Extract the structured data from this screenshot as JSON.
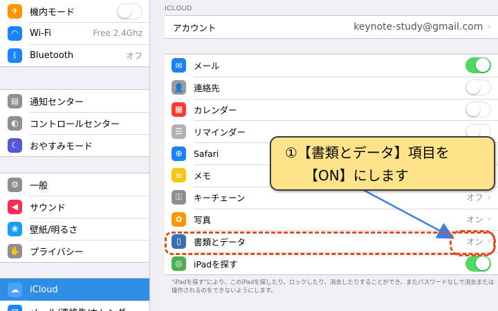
{
  "sidebar": {
    "group1": [
      {
        "label": "機内モード",
        "icon": "airplane-icon",
        "glyph": "✈",
        "color": "#ff9500",
        "toggle": "off"
      },
      {
        "label": "Wi-Fi",
        "icon": "wifi-icon",
        "glyph": "◠",
        "color": "#1a82fb",
        "value": "Free 2.4Ghz"
      },
      {
        "label": "Bluetooth",
        "icon": "bluetooth-icon",
        "glyph": "ᛒ",
        "color": "#1a82fb",
        "value": "オフ"
      }
    ],
    "group2": [
      {
        "label": "通知センター",
        "icon": "notification-center-icon",
        "glyph": "▤",
        "color": "#8e8e93"
      },
      {
        "label": "コントロールセンター",
        "icon": "control-center-icon",
        "glyph": "◐",
        "color": "#8e8e93"
      },
      {
        "label": "おやすみモード",
        "icon": "moon-icon",
        "glyph": "☾",
        "color": "#5856d6"
      }
    ],
    "group3": [
      {
        "label": "一般",
        "icon": "gear-icon",
        "glyph": "⚙",
        "color": "#8e8e93"
      },
      {
        "label": "サウンド",
        "icon": "speaker-icon",
        "glyph": "◀",
        "color": "#ff2d55"
      },
      {
        "label": "壁紙/明るさ",
        "icon": "wallpaper-icon",
        "glyph": "❀",
        "color": "#1a9afb"
      },
      {
        "label": "プライバシー",
        "icon": "hand-icon",
        "glyph": "✋",
        "color": "#8e8e93"
      }
    ],
    "group4": [
      {
        "label": "iCloud",
        "icon": "icloud-icon",
        "glyph": "☁",
        "color": "#4aa3f5",
        "selected": true
      },
      {
        "label": "メール/連絡先/カレンダー",
        "icon": "mail-contacts-icon",
        "glyph": "✉",
        "color": "#1a82fb"
      }
    ]
  },
  "main": {
    "section_header": "ICLOUD",
    "account": {
      "label": "アカウント",
      "email": "keynote-study@gmail.com"
    },
    "items": [
      {
        "label": "メール",
        "icon": "mail-icon",
        "glyph": "✉",
        "color": "#1a82fb",
        "toggle": "on"
      },
      {
        "label": "連絡先",
        "icon": "contacts-icon",
        "glyph": "👤",
        "color": "#9a9a9f",
        "toggle": "off"
      },
      {
        "label": "カレンダー",
        "icon": "calendar-icon",
        "glyph": "▦",
        "color": "#ff3b30",
        "toggle": "off"
      },
      {
        "label": "リマインダー",
        "icon": "reminders-icon",
        "glyph": "☰",
        "color": "#b0b0b5",
        "toggle": "off"
      },
      {
        "label": "Safari",
        "icon": "safari-icon",
        "glyph": "⊕",
        "color": "#1a82fb"
      },
      {
        "label": "メモ",
        "icon": "notes-icon",
        "glyph": "≡",
        "color": "#f5c518"
      },
      {
        "label": "キーチェーン",
        "icon": "keychain-icon",
        "glyph": "⚿",
        "color": "#8e8e93",
        "value": "オフ"
      },
      {
        "label": "写真",
        "icon": "photos-icon",
        "glyph": "✿",
        "color": "#ff9500",
        "value": "オン"
      },
      {
        "label": "書類とデータ",
        "icon": "documents-icon",
        "glyph": "▯",
        "color": "#3a6fb5",
        "value": "オン"
      },
      {
        "label": "iPadを探す",
        "icon": "find-my-ipad-icon",
        "glyph": "◎",
        "color": "#4caf50",
        "toggle": "on"
      }
    ],
    "footnote": "\"iPadを探す\"により、このiPadを探したり、ロックしたり、消去したりすることができ、またパスワードなしで消去または操作されるのをできないようにします。"
  },
  "annotation": {
    "callout_line1": "①【書類とデータ】項目を",
    "callout_line2": "【ON】にします",
    "callout_color": "#ffe38a",
    "highlight_color": "#e34a1c",
    "arrow_color": "#3a80e8"
  }
}
